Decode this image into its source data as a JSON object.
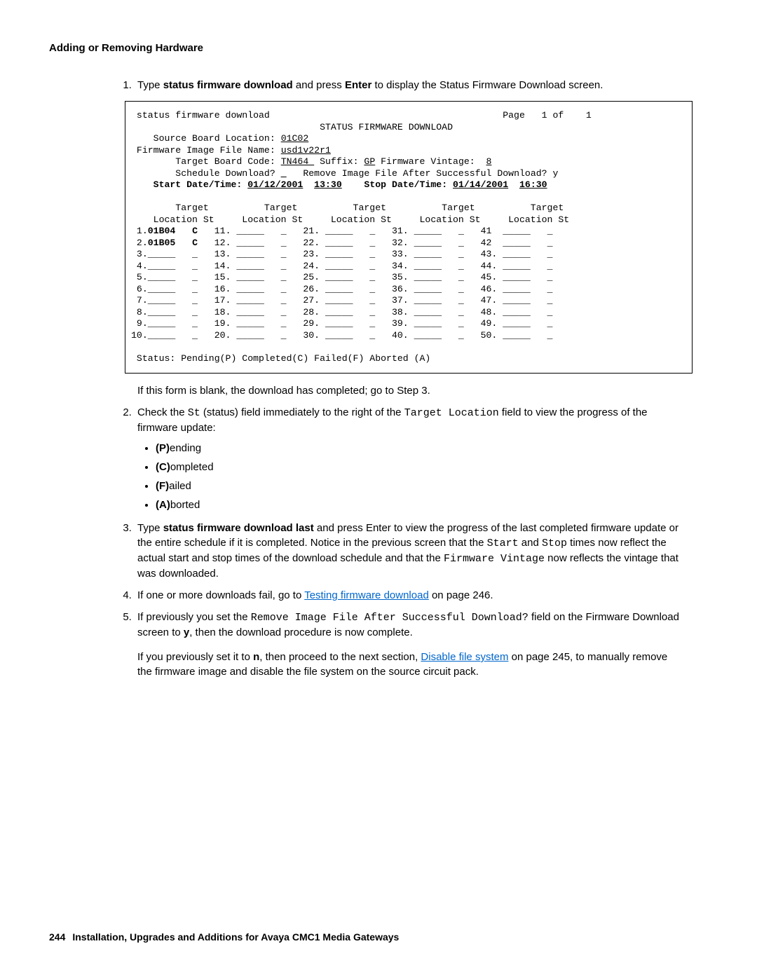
{
  "header": {
    "title": "Adding or Removing Hardware"
  },
  "step1": {
    "pre": "Type ",
    "cmd": "status firmware download",
    "mid": " and press ",
    "enter": "Enter",
    "post": " to display the Status Firmware Download screen."
  },
  "after_box": "If this form is blank, the download has completed; go to Step 3.",
  "step2": {
    "a": "Check the ",
    "st": "St",
    "b": " (status) field immediately to the right of the ",
    "tl": "Target Location",
    "c": " field to view the progress of the firmware update:"
  },
  "bullets": {
    "p": {
      "b": "(P)",
      "t": "ending"
    },
    "c": {
      "b": "(C)",
      "t": "ompleted"
    },
    "f": {
      "b": "(F)",
      "t": "ailed"
    },
    "a": {
      "b": "(A)",
      "t": "borted"
    }
  },
  "step3": {
    "a": "Type ",
    "cmd": "status firmware download last",
    "b": " and press Enter to view the progress of the last completed firmware update or the entire schedule if it is completed. Notice in the previous screen that the ",
    "start": "Start",
    "c": " and ",
    "stop": "Stop",
    "d": " times now reflect the actual start and stop times of the download schedule and that the ",
    "fv": "Firmware Vintage",
    "e": " now reflects the vintage that was downloaded."
  },
  "step4": {
    "a": "If one or more downloads fail, go to ",
    "link": "Testing firmware download",
    "b": " on page 246."
  },
  "step5": {
    "a": "If previously you set the ",
    "field": "Remove Image File After Successful Download?",
    "b": " field on the Firmware Download screen to ",
    "y": "y",
    "c": ", then the download procedure is now complete.",
    "d": "If you previously set it to ",
    "n": "n",
    "e": ", then proceed to the next section, ",
    "link": "Disable file system",
    "f": " on page 245, to manually remove the firmware image and disable the file system on the source circuit pack."
  },
  "footer": {
    "page_num": "244",
    "title": "Installation, Upgrades and Additions for Avaya CMC1 Media Gateways"
  },
  "term": {
    "cmd": "status firmware download",
    "page_ind": "Page   1 of    1",
    "title": "STATUS FIRMWARE DOWNLOAD",
    "source_lbl": "Source Board Location:",
    "source_val": "01C02",
    "fi_lbl": "Firmware Image File Name:",
    "fi_val": "usd1v22r1",
    "tbc_lbl": "Target Board Code:",
    "tbc_val": "TN464",
    "suffix_lbl": "Suffix:",
    "suffix_val": "GP",
    "fv_lbl": "Firmware Vintage:",
    "fv_val": "8",
    "sched_lbl": "Schedule Download?",
    "sched_val": "_",
    "rem_lbl": "Remove Image File After Successful Download?",
    "rem_val": "y",
    "start_lbl": "Start Date/Time:",
    "start_date": "01/12/2001",
    "start_time": "13:30",
    "stop_lbl": "Stop Date/Time:",
    "stop_date": "01/14/2001",
    "stop_time": "16:30",
    "hdr_t": "Target",
    "hdr_loc": "Location",
    "hdr_st": "St",
    "rows": [
      {
        "n": "1",
        "loc": "01B04",
        "st": "C",
        "bold": true,
        "dot": true
      },
      {
        "n": "2",
        "loc": "01B05",
        "st": "C",
        "bold": true,
        "dot": true
      },
      {
        "n": "3",
        "loc": "_____",
        "st": "_",
        "bold": false,
        "dot": true
      },
      {
        "n": "4",
        "loc": "_____",
        "st": "_",
        "bold": false,
        "dot": true
      },
      {
        "n": "5",
        "loc": "_____",
        "st": "_",
        "bold": false,
        "dot": true
      },
      {
        "n": "6",
        "loc": "_____",
        "st": "_",
        "bold": false,
        "dot": true
      },
      {
        "n": "7",
        "loc": "_____",
        "st": "_",
        "bold": false,
        "dot": true
      },
      {
        "n": "8",
        "loc": "_____",
        "st": "_",
        "bold": false,
        "dot": true
      },
      {
        "n": "9",
        "loc": "_____",
        "st": "_",
        "bold": false,
        "dot": true
      },
      {
        "n": "10",
        "loc": "_____",
        "st": "_",
        "bold": false,
        "dot": true
      }
    ],
    "cols_start": [
      11,
      21,
      31,
      41
    ],
    "status_legend": "Status: Pending(P) Completed(C) Failed(F) Aborted (A)"
  }
}
